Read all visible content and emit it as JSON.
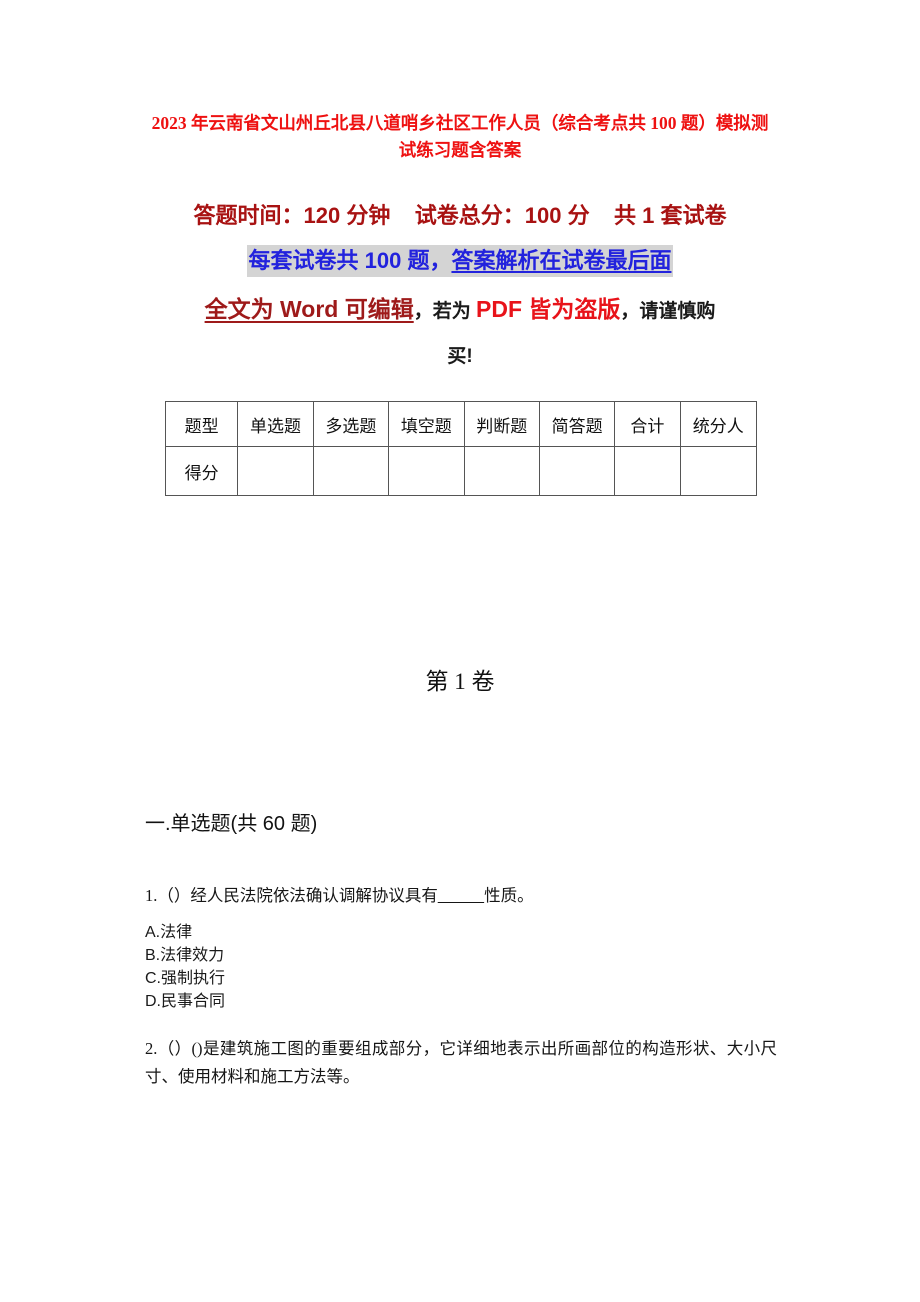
{
  "document": {
    "title": "2023 年云南省文山州丘北县八道哨乡社区工作人员（综合考点共 100 题）模拟测试练习题含答案",
    "info": {
      "line1": "答题时间：120 分钟    试卷总分：100 分    共 1 套试卷",
      "line2_plain": "每套试卷共 100 题，",
      "line2_underlined": "答案解析在试卷最后面",
      "line3_word": "全文为 Word 可编辑",
      "line3_ruowei": "，若为 ",
      "line3_pdf": "PDF 皆为盗版",
      "line3_tail": "，请谨慎购",
      "line4": "买!"
    },
    "score_table": {
      "headers": [
        "题型",
        "单选题",
        "多选题",
        "填空题",
        "判断题",
        "简答题",
        "合计",
        "统分人"
      ],
      "rows": [
        {
          "label": "得分",
          "cells": [
            "",
            "",
            "",
            "",
            "",
            "",
            ""
          ]
        }
      ]
    },
    "volume_heading": "第 1 卷",
    "section_heading": "一.单选题(共 60 题)",
    "questions": [
      {
        "stem_before": "1.（）经人民法院依法确认调解协议具有",
        "blank": "_____",
        "stem_after": "性质。",
        "options": [
          "A.法律",
          "B.法律效力",
          "C.强制执行",
          "D.民事合同"
        ]
      },
      {
        "stem": "2.（）()是建筑施工图的重要组成部分，它详细地表示出所画部位的构造形状、大小尺寸、使用材料和施工方法等。",
        "options": []
      }
    ]
  },
  "colors": {
    "title_red": "#ee1111",
    "info_crimson": "#a81212",
    "info_blue": "#2222dd",
    "highlight_gray": "#d4d4d4",
    "pdf_red": "#e8131a",
    "word_red": "#9e1a1a",
    "table_border": "#555555"
  }
}
